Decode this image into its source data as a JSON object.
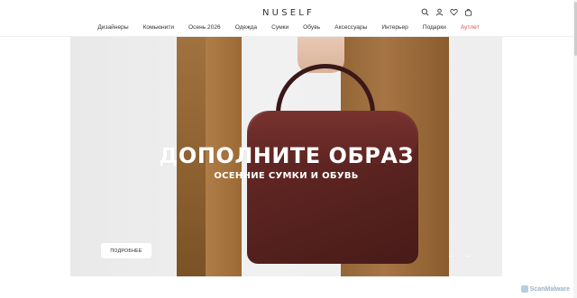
{
  "brand": {
    "logo": "NUSELF"
  },
  "header_icons": [
    "search-icon",
    "user-icon",
    "heart-icon",
    "bag-icon"
  ],
  "nav": {
    "items": [
      "Дизайнеры",
      "Комьюнити",
      "Осень 2026",
      "Одежда",
      "Сумки",
      "Обувь",
      "Аксессуары",
      "Интерьер",
      "Подарки",
      "Аутлет"
    ]
  },
  "hero": {
    "title": "ДОПОЛНИТЕ ОБРАЗ",
    "subtitle": "ОСЕННИЕ СУМКИ И ОБУВЬ",
    "button": "ПОДРОБНЕЕ",
    "prev_arrow": "←",
    "next_arrow": "→"
  },
  "watermark": {
    "text": "ScanMalware"
  },
  "colors": {
    "outlet": "#d9534f",
    "background": "#ffffff",
    "bag": "#5a2320",
    "coat": "#9a6a36"
  }
}
